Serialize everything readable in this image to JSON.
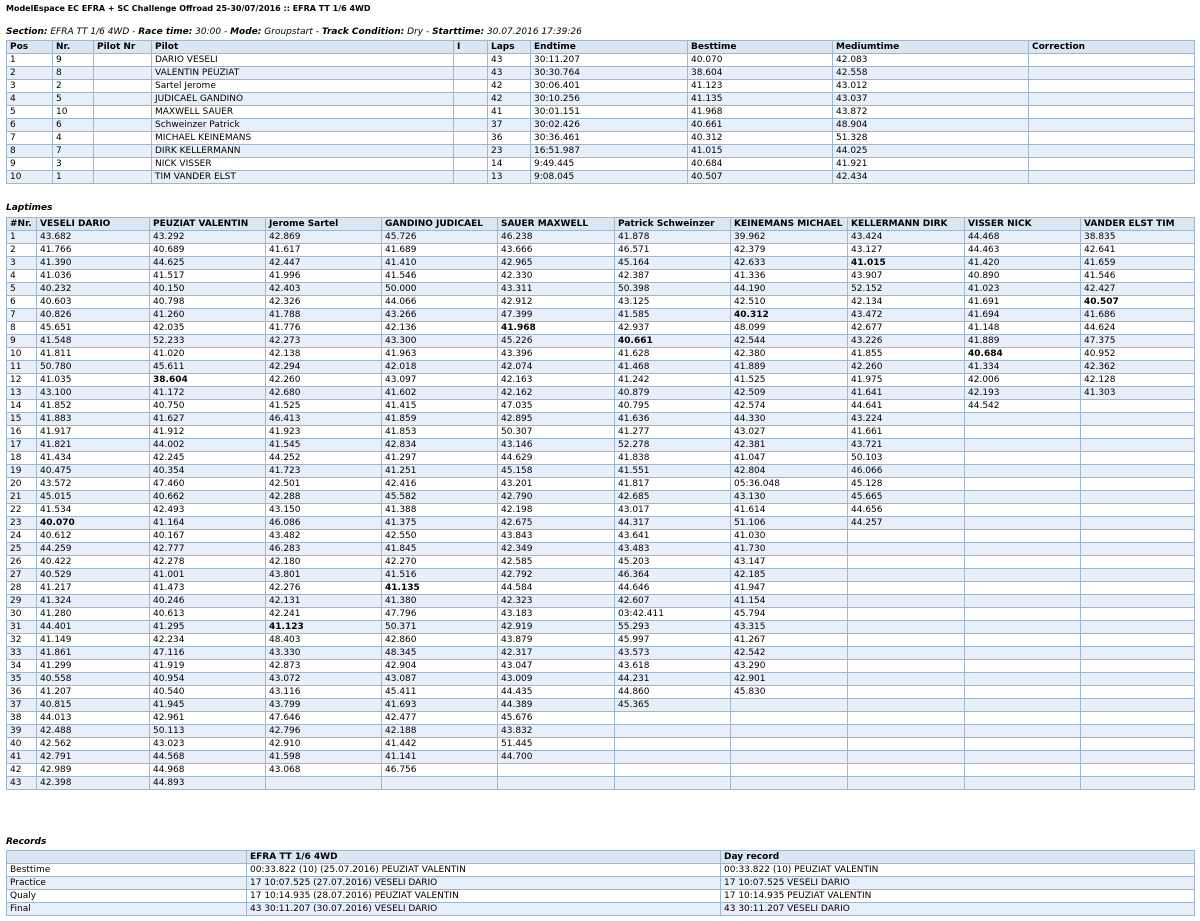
{
  "header": "ModelEspace EC EFRA + SC Challenge Offroad 25-30/07/2016 :: EFRA TT 1/6 4WD",
  "section": {
    "l1": "Section:",
    "v1": "EFRA TT 1/6 4WD",
    "l2": "Race time:",
    "v2": "30:00",
    "l3": "Mode:",
    "v3": "Groupstart",
    "l4": "Track Condition:",
    "v4": "Dry",
    "l5": "Starttime:",
    "v5": "30.07.2016 17:39:26"
  },
  "results": {
    "columns": [
      "Pos",
      "Nr.",
      "Pilot Nr",
      "Pilot",
      "I",
      "Laps",
      "Endtime",
      "Besttime",
      "Mediumtime",
      "Correction"
    ],
    "rows": [
      [
        "1",
        "9",
        "",
        "DARIO VESELI",
        "",
        "43",
        "30:11.207",
        "40.070",
        "42.083",
        ""
      ],
      [
        "2",
        "8",
        "",
        "VALENTIN PEUZIAT",
        "",
        "43",
        "30:30.764",
        "38.604",
        "42.558",
        ""
      ],
      [
        "3",
        "2",
        "",
        "Sartel Jerome",
        "",
        "42",
        "30:06.401",
        "41.123",
        "43.012",
        ""
      ],
      [
        "4",
        "5",
        "",
        "JUDICAEL GANDINO",
        "",
        "42",
        "30:10.256",
        "41.135",
        "43.037",
        ""
      ],
      [
        "5",
        "10",
        "",
        "MAXWELL SAUER",
        "",
        "41",
        "30:01.151",
        "41.968",
        "43.872",
        ""
      ],
      [
        "6",
        "6",
        "",
        "Schweinzer Patrick",
        "",
        "37",
        "30:02.426",
        "40.661",
        "48.904",
        ""
      ],
      [
        "7",
        "4",
        "",
        "MICHAEL KEINEMANS",
        "",
        "36",
        "30:36.461",
        "40.312",
        "51.328",
        ""
      ],
      [
        "8",
        "7",
        "",
        "DIRK KELLERMANN",
        "",
        "23",
        "16:51.987",
        "41.015",
        "44.025",
        ""
      ],
      [
        "9",
        "3",
        "",
        "NICK VISSER",
        "",
        "14",
        "9:49.445",
        "40.684",
        "41.921",
        ""
      ],
      [
        "10",
        "1",
        "",
        "TIM VANDER ELST",
        "",
        "13",
        "9:08.045",
        "40.507",
        "42.434",
        ""
      ]
    ]
  },
  "laptimes": {
    "title": "Laptimes",
    "columns": [
      "#Nr.",
      "VESELI DARIO",
      "PEUZIAT VALENTIN",
      "Jerome Sartel",
      "GANDINO JUDICAEL",
      "SAUER MAXWELL",
      "Patrick Schweinzer",
      "KEINEMANS MICHAEL",
      "KELLERMANN DIRK",
      "VISSER NICK",
      "VANDER ELST TIM"
    ],
    "pilots": [
      [
        "43.682",
        "41.766",
        "41.390",
        "41.036",
        "40.232",
        "40.603",
        "40.826",
        "45.651",
        "41.548",
        "41.811",
        "50.780",
        "41.035",
        "43.100",
        "41.852",
        "41.883",
        "41.917",
        "41.821",
        "41.434",
        "40.475",
        "43.572",
        "45.015",
        "41.534",
        "40.070",
        "40.612",
        "44.259",
        "40.422",
        "40.529",
        "41.217",
        "41.324",
        "41.280",
        "44.401",
        "41.149",
        "41.861",
        "41.299",
        "40.558",
        "41.207",
        "40.815",
        "44.013",
        "42.488",
        "42.562",
        "42.791",
        "42.989",
        "42.398"
      ],
      [
        "43.292",
        "40.689",
        "44.625",
        "41.517",
        "40.150",
        "40.798",
        "41.260",
        "42.035",
        "52.233",
        "41.020",
        "45.611",
        "38.604",
        "41.172",
        "40.750",
        "41.627",
        "41.912",
        "44.002",
        "42.245",
        "40.354",
        "47.460",
        "40.662",
        "42.493",
        "41.164",
        "40.167",
        "42.777",
        "42.278",
        "41.001",
        "41.473",
        "40.246",
        "40.613",
        "41.295",
        "42.234",
        "47.116",
        "41.919",
        "40.954",
        "40.540",
        "41.945",
        "42.961",
        "50.113",
        "43.023",
        "44.568",
        "44.968",
        "44.893"
      ],
      [
        "42.869",
        "41.617",
        "42.447",
        "41.996",
        "42.403",
        "42.326",
        "41.788",
        "41.776",
        "42.273",
        "42.138",
        "42.294",
        "42.260",
        "42.680",
        "41.525",
        "46.413",
        "41.923",
        "41.545",
        "44.252",
        "41.723",
        "42.501",
        "42.288",
        "43.150",
        "46.086",
        "43.482",
        "46.283",
        "42.180",
        "43.801",
        "42.276",
        "42.131",
        "42.241",
        "41.123",
        "48.403",
        "43.330",
        "42.873",
        "43.072",
        "43.116",
        "43.799",
        "47.646",
        "42.796",
        "42.910",
        "41.598",
        "43.068"
      ],
      [
        "45.726",
        "41.689",
        "41.410",
        "41.546",
        "50.000",
        "44.066",
        "43.266",
        "42.136",
        "43.300",
        "41.963",
        "42.018",
        "43.097",
        "41.602",
        "41.415",
        "41.859",
        "41.853",
        "42.834",
        "41.297",
        "41.251",
        "42.416",
        "45.582",
        "41.388",
        "41.375",
        "42.550",
        "41.845",
        "42.270",
        "41.516",
        "41.135",
        "41.380",
        "47.796",
        "50.371",
        "42.860",
        "48.345",
        "42.904",
        "43.087",
        "45.411",
        "41.693",
        "42.477",
        "42.188",
        "41.442",
        "41.141",
        "46.756"
      ],
      [
        "46.238",
        "43.666",
        "42.965",
        "42.330",
        "43.311",
        "42.912",
        "47.399",
        "41.968",
        "45.226",
        "43.396",
        "42.074",
        "42.163",
        "42.162",
        "47.035",
        "42.895",
        "50.307",
        "43.146",
        "44.629",
        "45.158",
        "43.201",
        "42.790",
        "42.198",
        "42.675",
        "43.843",
        "42.349",
        "42.585",
        "42.792",
        "44.584",
        "42.323",
        "43.183",
        "42.919",
        "43.879",
        "42.317",
        "43.047",
        "43.009",
        "44.435",
        "44.389",
        "45.676",
        "43.832",
        "51.445",
        "44.700"
      ],
      [
        "41.878",
        "46.571",
        "45.164",
        "42.387",
        "50.398",
        "43.125",
        "41.585",
        "42.937",
        "40.661",
        "41.628",
        "41.468",
        "41.242",
        "40.879",
        "40.795",
        "41.636",
        "41.277",
        "52.278",
        "41.838",
        "41.551",
        "41.817",
        "42.685",
        "43.017",
        "44.317",
        "43.641",
        "43.483",
        "45.203",
        "46.364",
        "44.646",
        "42.607",
        "03:42.411",
        "55.293",
        "45.997",
        "43.573",
        "43.618",
        "44.231",
        "44.860",
        "45.365"
      ],
      [
        "39.962",
        "42.379",
        "42.633",
        "41.336",
        "44.190",
        "42.510",
        "40.312",
        "48.099",
        "42.544",
        "42.380",
        "41.889",
        "41.525",
        "42.509",
        "42.574",
        "44.330",
        "43.027",
        "42.381",
        "41.047",
        "42.804",
        "05:36.048",
        "43.130",
        "41.614",
        "51.106",
        "41.030",
        "41.730",
        "43.147",
        "42.185",
        "41.947",
        "41.154",
        "45.794",
        "43.315",
        "41.267",
        "42.542",
        "43.290",
        "42.901",
        "45.830"
      ],
      [
        "43.424",
        "43.127",
        "41.015",
        "43.907",
        "52.152",
        "42.134",
        "43.472",
        "42.677",
        "43.226",
        "41.855",
        "42.260",
        "41.975",
        "41.641",
        "44.641",
        "43.224",
        "41.661",
        "43.721",
        "50.103",
        "46.066",
        "45.128",
        "45.665",
        "44.656",
        "44.257"
      ],
      [
        "44.468",
        "44.463",
        "41.420",
        "40.890",
        "41.023",
        "41.691",
        "41.694",
        "41.148",
        "41.889",
        "40.684",
        "41.334",
        "42.006",
        "42.193",
        "44.542"
      ],
      [
        "38.835",
        "42.641",
        "41.659",
        "41.546",
        "42.427",
        "40.507",
        "41.686",
        "44.624",
        "47.375",
        "40.952",
        "42.362",
        "42.128",
        "41.303"
      ]
    ],
    "best_laps": [
      23,
      12,
      31,
      28,
      8,
      9,
      7,
      3,
      10,
      6
    ]
  },
  "records": {
    "title": "Records",
    "columns": [
      "",
      "EFRA TT 1/6 4WD",
      "Day record"
    ],
    "rows": [
      [
        "Besttime",
        "00:33.822 (10) (25.07.2016) PEUZIAT VALENTIN",
        "00:33.822 (10) PEUZIAT VALENTIN"
      ],
      [
        "Practice",
        "17 10:07.525 (27.07.2016) VESELI DARIO",
        "17 10:07.525 VESELI DARIO"
      ],
      [
        "Qualy",
        "17 10:14.935 (28.07.2016) PEUZIAT VALENTIN",
        "17 10:14.935 PEUZIAT VALENTIN"
      ],
      [
        "Final",
        "43 30:11.207 (30.07.2016) VESELI DARIO",
        "43 30:11.207 VESELI DARIO"
      ]
    ]
  }
}
